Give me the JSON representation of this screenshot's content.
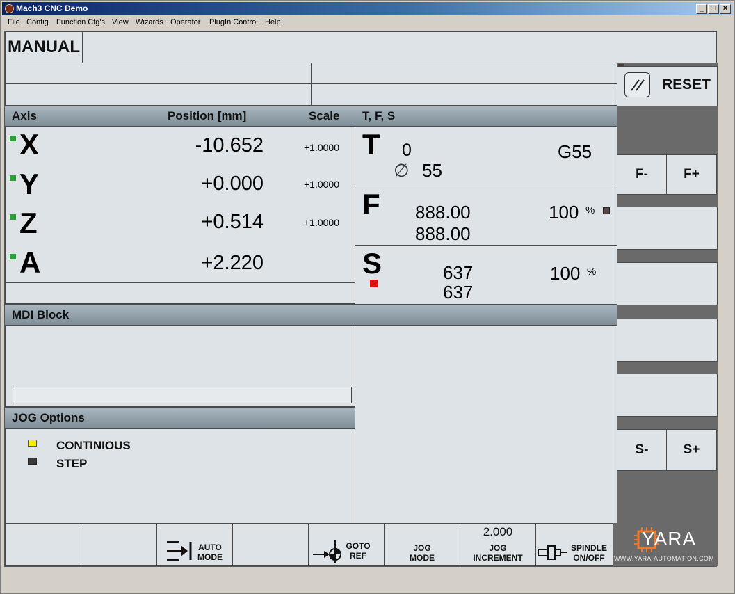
{
  "window": {
    "title": "Mach3 CNC  Demo",
    "controls": [
      "_",
      "□",
      "×"
    ]
  },
  "menu": [
    "File",
    "Config",
    "Function Cfg's",
    "View",
    "Wizards",
    "Operator",
    "PlugIn Control",
    "Help"
  ],
  "mode_label": "MANUAL",
  "reset_label": "RESET",
  "axis_panel": {
    "header_axis": "Axis",
    "header_position": "Position [mm]",
    "header_scale": "Scale",
    "axes": [
      {
        "name": "X",
        "position": "-10.652",
        "scale": "+1.0000"
      },
      {
        "name": "Y",
        "position": "+0.000",
        "scale": "+1.0000"
      },
      {
        "name": "Z",
        "position": "+0.514",
        "scale": "+1.0000"
      },
      {
        "name": "A",
        "position": "+2.220",
        "scale": ""
      }
    ]
  },
  "tfs_panel": {
    "header": "T, F, S",
    "t_letter": "T",
    "tool_number": "0",
    "diameter_symbol": "∅",
    "tool_diameter": "55",
    "work_offset": "G55",
    "f_letter": "F",
    "feed_set": "888.00",
    "feed_actual": "888.00",
    "feed_override": "100",
    "s_letter": "S",
    "spindle_set": "637",
    "spindle_actual": "637",
    "spindle_override": "100",
    "percent": "%"
  },
  "mdi": {
    "header": "MDI Block",
    "input_value": ""
  },
  "jog_options": {
    "header": "JOG Options",
    "continuous": "CONTINIOUS",
    "step": "STEP"
  },
  "side_buttons": {
    "f_minus": "F-",
    "f_plus": "F+",
    "s_minus": "S-",
    "s_plus": "S+"
  },
  "bottom_bar": {
    "auto_mode": [
      "AUTO",
      "MODE"
    ],
    "goto_ref": [
      "GOTO",
      "REF"
    ],
    "jog_mode": [
      "JOG",
      "MODE"
    ],
    "jog_increment_value": "2.000",
    "jog_increment": [
      "JOG",
      "INCREMENT"
    ],
    "spindle": [
      "SPINDLE",
      "ON/OFF"
    ]
  },
  "logo": {
    "brand": "YARA",
    "url": "WWW.YARA-AUTOMATION.COM"
  },
  "colors": {
    "led_green": "#2e9e3a",
    "led_yellow": "#ffee00",
    "led_dark": "#3a3a3a",
    "led_red": "#e01010",
    "logo_orange": "#f07a2a"
  }
}
